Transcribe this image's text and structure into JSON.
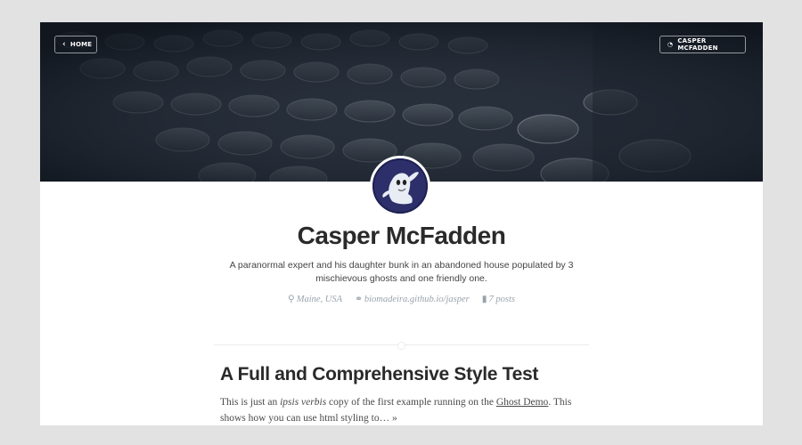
{
  "nav": {
    "home_label": "HOME",
    "subscribe_label": "CASPER MCFADDEN"
  },
  "icons": {
    "home": "chevron-left-icon",
    "subscribe": "rss-icon",
    "location": "map-marker-icon",
    "website": "link-icon",
    "posts": "bar-chart-icon"
  },
  "author": {
    "name": "Casper McFadden",
    "bio": "A paranormal expert and his daughter bunk in an abandoned house populated by 3 mischievous ghosts and one friendly one.",
    "location": "Maine, USA",
    "website": "biomadeira.github.io/jasper",
    "posts": "7 posts"
  },
  "post": {
    "title": "A Full and Comprehensive Style Test",
    "excerpt_part1": "This is just an ",
    "excerpt_em": "ipsis verbis",
    "excerpt_part2": " copy of the first example running on the ",
    "excerpt_link": "Ghost Demo",
    "excerpt_part3": ". This shows how you can use html styling to… »"
  },
  "colors": {
    "page_bg": "#e2e2e2",
    "cover_bg": "#1b2330",
    "title_text": "#2a2a2a",
    "meta_text": "#9aa3ab"
  }
}
